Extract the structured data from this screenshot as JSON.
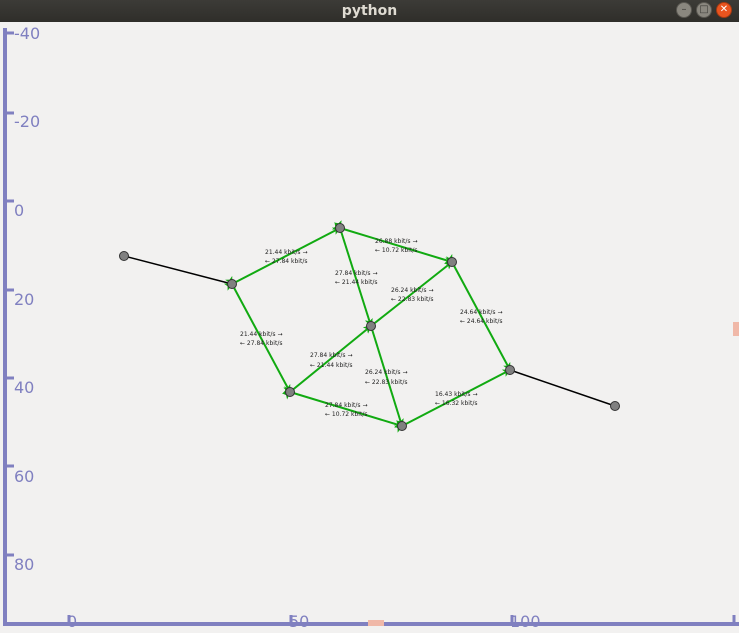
{
  "window": {
    "title": "python",
    "minimize_label": "–",
    "maximize_label": "□",
    "close_label": "✕",
    "minimize_icon": "minimize-icon",
    "maximize_icon": "maximize-icon",
    "close_icon": "close-icon"
  },
  "axes": {
    "y_ticks": [
      "-40",
      "-20",
      "0",
      "20",
      "40",
      "60",
      "80"
    ],
    "x_ticks": [
      "0",
      "50",
      "100"
    ],
    "color": "#8080c0"
  },
  "graph": {
    "edge_color_active": "#11aa11",
    "edge_color_plain": "#000000",
    "node_color": "#808080",
    "labels": [
      {
        "line1": "21.44 kbit/s →",
        "line2": "← 27.84 kbit/s"
      },
      {
        "line1": "26.88 kbit/s →",
        "line2": "← 10.72 kbit/s"
      },
      {
        "line1": "27.84 kbit/s →",
        "line2": "← 21.44 kbit/s"
      },
      {
        "line1": "26.24 kbit/s →",
        "line2": "← 22.83 kbit/s"
      },
      {
        "line1": "24.64 kbit/s →",
        "line2": "← 24.64 kbit/s"
      },
      {
        "line1": "21.44 kbit/s →",
        "line2": "← 27.84 kbit/s"
      },
      {
        "line1": "27.84 kbit/s →",
        "line2": "← 21.44 kbit/s"
      },
      {
        "line1": "26.24 kbit/s →",
        "line2": "← 22.83 kbit/s"
      },
      {
        "line1": "27.84 kbit/s →",
        "line2": "← 10.72 kbit/s"
      },
      {
        "line1": "16.43 kbit/s →",
        "line2": "← 16.32 kbit/s"
      }
    ]
  }
}
